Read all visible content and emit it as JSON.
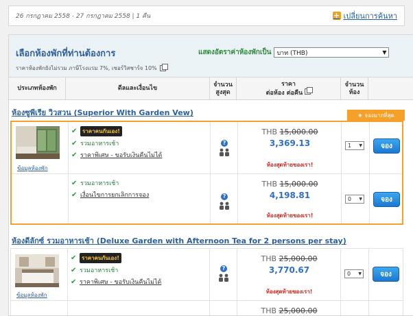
{
  "search": {
    "dates": "26 กรกฎาคม 2558 - 27 กรกฎาคม 2558 | 1 คืน",
    "change_label": "เปลี่ยนการค้นหา"
  },
  "panel": {
    "title": "เลือกห้องพักที่ท่านต้องการ",
    "tax_note": "ราคาห้องพักยังไม่รวม ภาษีโรงแรม 7%, เซอร์วิสชาร์จ 10%",
    "currency_label": "แสดงอัตราค่าห้องพักเป็น",
    "currency_value": "บาท (THB)"
  },
  "columns": {
    "room_type": "ประเภทห้องพัก",
    "conditions": "ดีลและเงื่อนไข",
    "max_occ_1": "จำนวน",
    "max_occ_2": "สูงสุด",
    "price_1": "ราคา",
    "price_2": "ต่อห้อง ต่อคืน",
    "rooms_1": "จำนวน",
    "rooms_2": "ห้อง"
  },
  "badges": {
    "best_seller": "จองมากที่สุด",
    "hot_deal": "ราคาคนกันเอง!",
    "book_label": "จอง",
    "view_room": "ข้อมูลห้องพัก",
    "lowest_price": "ห้องสุดท้ายของเรา!"
  },
  "rooms": [
    {
      "name": "ห้องซูพีเรีย วิวสวน (Superior With Garden Vew)",
      "rates": [
        {
          "conditions": [
            "รวมอาหารเช้า",
            "ราคาพิเศษ - ขอรับเงินคืนไม่ได้"
          ],
          "currency": "THB",
          "old_price": "15,000.00",
          "new_price": "3,369.13",
          "qty": "1"
        },
        {
          "conditions": [
            "รวมอาหารเช้า",
            "เงื่อนไขการยกเลิกการจอง"
          ],
          "currency": "THB",
          "old_price": "15,000.00",
          "new_price": "4,198.81",
          "qty": "0"
        }
      ]
    },
    {
      "name": "ห้องดีลักซ์ รวมอาหารเช้า (Deluxe Garden with Afternoon Tea for 2 persons per stay)",
      "rates": [
        {
          "conditions": [
            "รวมอาหารเช้า",
            "ราคาพิเศษ - ขอรับเงินคืนไม่ได้"
          ],
          "currency": "THB",
          "old_price": "25,000.00",
          "new_price": "3,770.67",
          "qty": "0"
        },
        {
          "conditions": [],
          "currency": "THB",
          "old_price": "25,000.00"
        }
      ]
    }
  ]
}
